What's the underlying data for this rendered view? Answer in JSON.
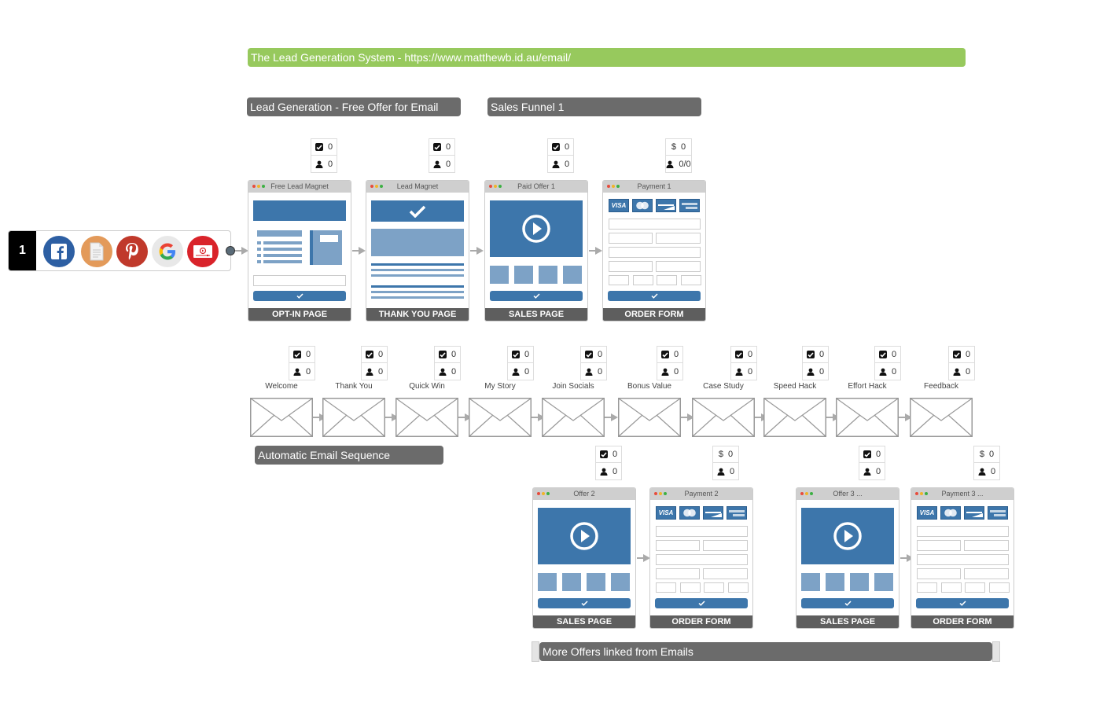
{
  "header": {
    "title": "The Lead Generation System - https://www.matthewb.id.au/email/"
  },
  "groups": {
    "lead_gen": "Lead Generation - Free Offer for Email",
    "sales_funnel": "Sales Funnel 1",
    "email_sequence": "Automatic Email Sequence",
    "more_offers": "More Offers linked from Emails"
  },
  "source": {
    "number": "1",
    "icons": [
      "facebook-icon",
      "document-icon",
      "pinterest-icon",
      "google-icon",
      "youtube-video-icon"
    ],
    "colors": {
      "facebook": "#2d5fa3",
      "document": "#e39a5a",
      "pinterest": "#c0392b",
      "google": "#e8e8e8",
      "video": "#d9232a"
    }
  },
  "funnel1": [
    {
      "title": "Free Lead Magnet",
      "type": "OPT-IN PAGE",
      "stat1_icon": "check",
      "stat1": "0",
      "stat2": "0"
    },
    {
      "title": "Lead Magnet",
      "type": "THANK YOU PAGE",
      "stat1_icon": "check",
      "stat1": "0",
      "stat2": "0"
    },
    {
      "title": "Paid Offer 1",
      "type": "SALES PAGE",
      "stat1_icon": "check",
      "stat1": "0",
      "stat2": "0"
    },
    {
      "title": "Payment 1",
      "type": "ORDER FORM",
      "stat1_icon": "dollar",
      "stat1": "0",
      "stat2": "0/0"
    }
  ],
  "emails": [
    {
      "label": "Welcome",
      "opens": "0",
      "people": "0"
    },
    {
      "label": "Thank You",
      "opens": "0",
      "people": "0"
    },
    {
      "label": "Quick Win",
      "opens": "0",
      "people": "0"
    },
    {
      "label": "My Story",
      "opens": "0",
      "people": "0"
    },
    {
      "label": "Join Socials",
      "opens": "0",
      "people": "0"
    },
    {
      "label": "Bonus Value",
      "opens": "0",
      "people": "0"
    },
    {
      "label": "Case Study",
      "opens": "0",
      "people": "0"
    },
    {
      "label": "Speed Hack",
      "opens": "0",
      "people": "0"
    },
    {
      "label": "Effort Hack",
      "opens": "0",
      "people": "0"
    },
    {
      "label": "Feedback",
      "opens": "0",
      "people": "0"
    }
  ],
  "offers": [
    {
      "title": "Offer 2",
      "type": "SALES PAGE",
      "stat1_icon": "check",
      "stat1": "0",
      "stat2": "0"
    },
    {
      "title": "Payment 2",
      "type": "ORDER FORM",
      "stat1_icon": "dollar",
      "stat1": "0",
      "stat2": "0"
    },
    {
      "title": "Offer 3 ...",
      "type": "SALES PAGE",
      "stat1_icon": "check",
      "stat1": "0",
      "stat2": "0"
    },
    {
      "title": "Payment 3 ...",
      "type": "ORDER FORM",
      "stat1_icon": "dollar",
      "stat1": "0",
      "stat2": "0"
    }
  ],
  "card_labels": {
    "visa": "VISA",
    "dollar": "$"
  },
  "colors": {
    "accent_green": "#97c95d",
    "group_gray": "#6b6b6b",
    "page_blue": "#3d76ab",
    "page_light_blue": "#7da2c6",
    "footer_gray": "#5e5e5e"
  }
}
